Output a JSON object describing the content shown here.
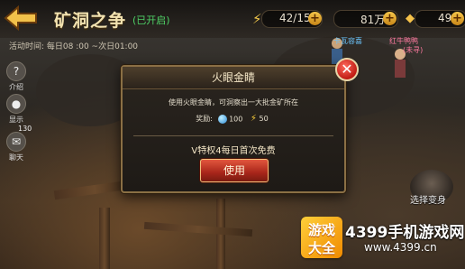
{
  "header": {
    "title": "矿洞之争",
    "status": "(已开启)",
    "activity_time": "活动时间: 每日08 :00 ~次日01:00"
  },
  "resources": [
    {
      "icon": "lightning-icon",
      "value": "42/150"
    },
    {
      "icon": "gold-ingot-icon",
      "value": "81万"
    },
    {
      "icon": "diamond-icon",
      "value": "49"
    }
  ],
  "side_menu": [
    {
      "icon": "help-icon",
      "label": "介绍"
    },
    {
      "icon": "person-icon",
      "label": "显示"
    },
    {
      "icon": "chat-icon",
      "label": "聊天"
    }
  ],
  "side_badge": "130",
  "world_labels": {
    "player1": "卡瓦容喜",
    "player2": "红牛鸭鸭",
    "tag": "(未寻)"
  },
  "transform_label": "选择变身",
  "dialog": {
    "title": "火眼金睛",
    "description": "使用火眼金睛，可洞察出一大批金矿所在",
    "reward_label": "奖励:",
    "rewards": [
      {
        "icon": "crystal-icon",
        "value": "100"
      },
      {
        "icon": "lightning-icon",
        "value": "50"
      }
    ],
    "vip_note": "V特权4每日首次免费",
    "use_button": "使用"
  },
  "watermark": {
    "logo_top": "游戏",
    "logo_bottom": "大全",
    "text": "4399手机游戏网",
    "url": "www.4399.cn"
  },
  "colors": {
    "title": "#f3e3b0",
    "status": "#4fd266",
    "dialog_border": "#8a6f44",
    "button_red": "#c0301f",
    "close_red": "#c01c14"
  }
}
